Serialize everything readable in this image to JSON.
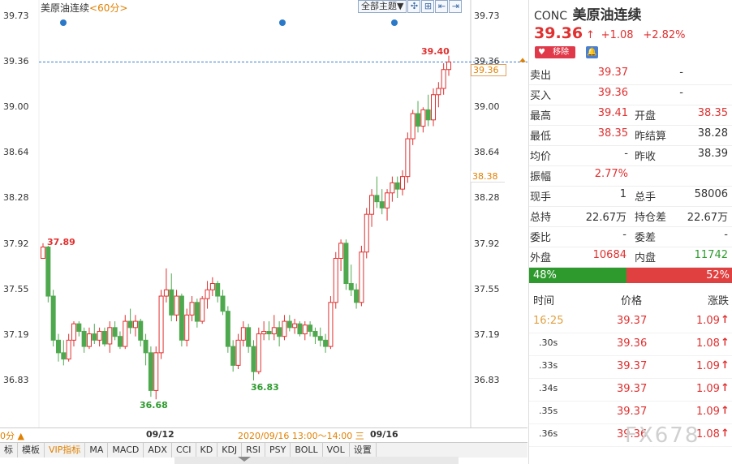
{
  "chart": {
    "title": "美原油连续",
    "timeframe": "<60分>",
    "toolbar_select": "全部主题▼",
    "y_ticks": [
      "39.73",
      "39.36",
      "39.00",
      "38.64",
      "38.28",
      "37.92",
      "37.55",
      "37.19",
      "36.83"
    ],
    "current_price_tag": "39.36",
    "prev_settle_tag": "38.38",
    "ann_high": "39.40",
    "ann_37_89": "37.89",
    "ann_low1": "36.68",
    "ann_low2": "36.83",
    "x_label_1": "09/12",
    "x_crosshair_time": "2020/09/16 13:00～14:00 三",
    "x_label_2": "09/16",
    "bottom_left": "0分 ▲",
    "indicator_tabs": [
      "标",
      "模板",
      "VIP指标",
      "MA",
      "MACD",
      "ADX",
      "CCI",
      "KD",
      "KDJ",
      "RSI",
      "PSY",
      "BOLL",
      "VOL",
      "设置"
    ],
    "colors": {
      "up": "#e03030",
      "down": "#4ea84e",
      "accent": "#e08000"
    },
    "candles": [
      [
        37.8,
        37.92,
        37.85,
        37.89
      ],
      [
        37.89,
        37.9,
        37.45,
        37.5
      ],
      [
        37.5,
        37.55,
        37.1,
        37.15
      ],
      [
        37.15,
        37.2,
        36.98,
        37.05
      ],
      [
        37.05,
        37.15,
        36.95,
        37.0
      ],
      [
        37.0,
        37.2,
        36.98,
        37.15
      ],
      [
        37.15,
        37.3,
        37.1,
        37.28
      ],
      [
        37.28,
        37.3,
        37.18,
        37.22
      ],
      [
        37.22,
        37.25,
        37.05,
        37.1
      ],
      [
        37.1,
        37.25,
        37.08,
        37.2
      ],
      [
        37.2,
        37.28,
        37.12,
        37.15
      ],
      [
        37.15,
        37.25,
        37.1,
        37.22
      ],
      [
        37.22,
        37.25,
        37.1,
        37.12
      ],
      [
        37.12,
        37.3,
        37.05,
        37.25
      ],
      [
        37.25,
        37.3,
        37.15,
        37.18
      ],
      [
        37.18,
        37.22,
        37.08,
        37.1
      ],
      [
        37.1,
        37.35,
        37.08,
        37.3
      ],
      [
        37.3,
        37.4,
        37.2,
        37.25
      ],
      [
        37.25,
        37.35,
        37.18,
        37.3
      ],
      [
        37.3,
        37.32,
        37.1,
        37.15
      ],
      [
        37.15,
        37.2,
        36.95,
        37.05
      ],
      [
        37.05,
        37.1,
        36.7,
        36.75
      ],
      [
        36.75,
        37.1,
        36.68,
        37.05
      ],
      [
        37.05,
        37.55,
        37.0,
        37.5
      ],
      [
        37.5,
        37.72,
        37.45,
        37.55
      ],
      [
        37.55,
        37.68,
        37.3,
        37.35
      ],
      [
        37.35,
        37.55,
        37.3,
        37.5
      ],
      [
        37.5,
        37.52,
        37.1,
        37.15
      ],
      [
        37.15,
        37.4,
        37.1,
        37.35
      ],
      [
        37.35,
        37.5,
        37.3,
        37.45
      ],
      [
        37.45,
        37.48,
        37.25,
        37.3
      ],
      [
        37.3,
        37.5,
        37.28,
        37.48
      ],
      [
        37.48,
        37.62,
        37.4,
        37.55
      ],
      [
        37.55,
        37.65,
        37.5,
        37.6
      ],
      [
        37.6,
        37.62,
        37.45,
        37.5
      ],
      [
        37.5,
        37.55,
        37.35,
        37.38
      ],
      [
        37.38,
        37.42,
        37.05,
        37.1
      ],
      [
        37.1,
        37.15,
        36.9,
        36.95
      ],
      [
        36.95,
        37.2,
        36.92,
        37.15
      ],
      [
        37.15,
        37.3,
        37.1,
        37.25
      ],
      [
        37.25,
        37.28,
        37.05,
        37.1
      ],
      [
        37.1,
        37.15,
        36.83,
        36.9
      ],
      [
        36.9,
        37.25,
        36.88,
        37.2
      ],
      [
        37.2,
        37.3,
        37.15,
        37.22
      ],
      [
        37.22,
        37.3,
        37.15,
        37.2
      ],
      [
        37.2,
        37.35,
        37.15,
        37.25
      ],
      [
        37.25,
        37.3,
        37.1,
        37.18
      ],
      [
        37.18,
        37.35,
        37.15,
        37.3
      ],
      [
        37.3,
        37.35,
        37.22,
        37.25
      ],
      [
        37.25,
        37.32,
        37.2,
        37.28
      ],
      [
        37.28,
        37.3,
        37.18,
        37.2
      ],
      [
        37.2,
        37.3,
        37.15,
        37.27
      ],
      [
        37.27,
        37.3,
        37.18,
        37.22
      ],
      [
        37.22,
        37.25,
        37.12,
        37.18
      ],
      [
        37.18,
        37.25,
        37.1,
        37.15
      ],
      [
        37.15,
        37.2,
        37.05,
        37.1
      ],
      [
        37.1,
        37.5,
        37.08,
        37.45
      ],
      [
        37.45,
        37.85,
        37.4,
        37.8
      ],
      [
        37.8,
        37.95,
        37.7,
        37.92
      ],
      [
        37.92,
        37.95,
        37.55,
        37.6
      ],
      [
        37.6,
        37.75,
        37.5,
        37.55
      ],
      [
        37.55,
        37.6,
        37.4,
        37.45
      ],
      [
        37.45,
        37.9,
        37.42,
        37.85
      ],
      [
        37.85,
        38.2,
        37.8,
        38.15
      ],
      [
        38.15,
        38.35,
        38.05,
        38.3
      ],
      [
        38.3,
        38.45,
        38.2,
        38.25
      ],
      [
        38.25,
        38.35,
        38.15,
        38.2
      ],
      [
        38.2,
        38.35,
        38.1,
        38.32
      ],
      [
        38.32,
        38.45,
        38.25,
        38.4
      ],
      [
        38.4,
        38.45,
        38.28,
        38.35
      ],
      [
        38.35,
        38.5,
        38.3,
        38.45
      ],
      [
        38.45,
        38.8,
        38.4,
        38.75
      ],
      [
        38.75,
        38.98,
        38.7,
        38.95
      ],
      [
        38.95,
        39.05,
        38.8,
        38.85
      ],
      [
        38.85,
        39.0,
        38.8,
        38.98
      ],
      [
        38.98,
        39.1,
        38.85,
        38.9
      ],
      [
        38.9,
        39.15,
        38.85,
        39.1
      ],
      [
        39.1,
        39.2,
        39.0,
        39.15
      ],
      [
        39.15,
        39.35,
        39.1,
        39.3
      ],
      [
        39.3,
        39.41,
        39.25,
        39.36
      ]
    ]
  },
  "quote": {
    "code": "CONC",
    "name": "美原油连续",
    "price": "39.36",
    "arrow": "↑",
    "change": "+1.08",
    "change_pct": "+2.82%",
    "remove_btn": "移除",
    "sell_label": "卖出",
    "sell_value": "39.37",
    "sell_qty": "-",
    "buy_label": "买入",
    "buy_value": "39.36",
    "buy_qty": "-",
    "high_label": "最高",
    "high_value": "39.41",
    "open_label": "开盘",
    "open_value": "38.35",
    "low_label": "最低",
    "low_value": "38.35",
    "prev_settle_label": "昨结算",
    "prev_settle_value": "38.28",
    "avg_label": "均价",
    "avg_value": "-",
    "prev_close_label": "昨收",
    "prev_close_value": "38.39",
    "amp_label": "振幅",
    "amp_value": "2.77%",
    "cur_vol_label": "现手",
    "cur_vol_value": "1",
    "total_vol_label": "总手",
    "total_vol_value": "58006",
    "oi_label": "总持",
    "oi_value": "22.67万",
    "oi_diff_label": "持仓差",
    "oi_diff_value": "22.67万",
    "ratio_label": "委比",
    "ratio_value": "-",
    "diff_label": "委差",
    "diff_value": "-",
    "outer_label": "外盘",
    "outer_value": "10684",
    "inner_label": "内盘",
    "inner_value": "11742",
    "bar_left": "48%",
    "bar_left_fraction": 0.48,
    "bar_right": "52%",
    "ticks_headers": [
      "时间",
      "价格",
      "涨跌"
    ],
    "ticks": [
      {
        "time": "16:25",
        "price": "39.37",
        "chg": "1.09",
        "arrow": "↑"
      },
      {
        "time": ".30s",
        "price": "39.36",
        "chg": "1.08",
        "arrow": "↑"
      },
      {
        "time": ".33s",
        "price": "39.37",
        "chg": "1.09",
        "arrow": "↑"
      },
      {
        "time": ".34s",
        "price": "39.37",
        "chg": "1.09",
        "arrow": "↑"
      },
      {
        "time": ".35s",
        "price": "39.37",
        "chg": "1.09",
        "arrow": "↑"
      },
      {
        "time": ".36s",
        "price": "39.36",
        "chg": "1.08",
        "arrow": "↑"
      }
    ],
    "watermark": "FX678"
  }
}
